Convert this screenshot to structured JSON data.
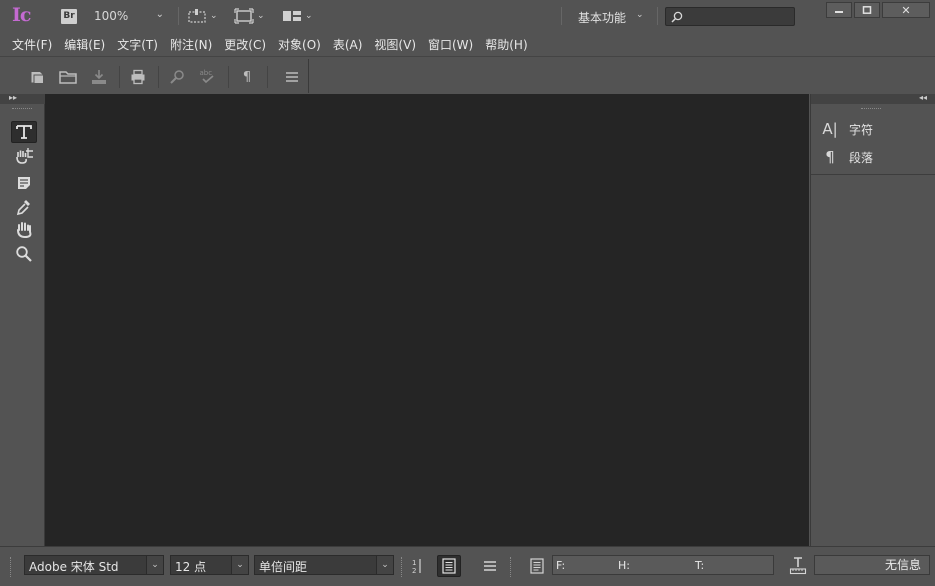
{
  "app": {
    "logo_text": "Ic",
    "bridge_badge": "Br"
  },
  "titlebar": {
    "zoom": "100%",
    "workspace": "基本功能",
    "search_placeholder": ""
  },
  "window_controls": {
    "minimize": "▬",
    "maximize": "□",
    "close": "✕"
  },
  "menu": [
    "文件(F)",
    "编辑(E)",
    "文字(T)",
    "附注(N)",
    "更改(C)",
    "对象(O)",
    "表(A)",
    "视图(V)",
    "窗口(W)",
    "帮助(H)"
  ],
  "toolbox": {
    "tools": [
      "type-tool",
      "position-tool",
      "note-tool",
      "eyedropper-tool",
      "hand-tool",
      "zoom-tool"
    ],
    "active": "type-tool"
  },
  "right_panel": {
    "items": [
      {
        "glyph": "A|",
        "label": "字符"
      },
      {
        "glyph": "¶",
        "label": "段落"
      }
    ]
  },
  "statusbar": {
    "font": "Adobe 宋体 Std",
    "size": "12 点",
    "spacing": "单倍间距",
    "f_label": "F:",
    "h_label": "H:",
    "t_label": "T:",
    "info": "无信息"
  },
  "colors": {
    "accent": "#c46ad1",
    "canvas": "#252525",
    "chrome": "#535353"
  }
}
